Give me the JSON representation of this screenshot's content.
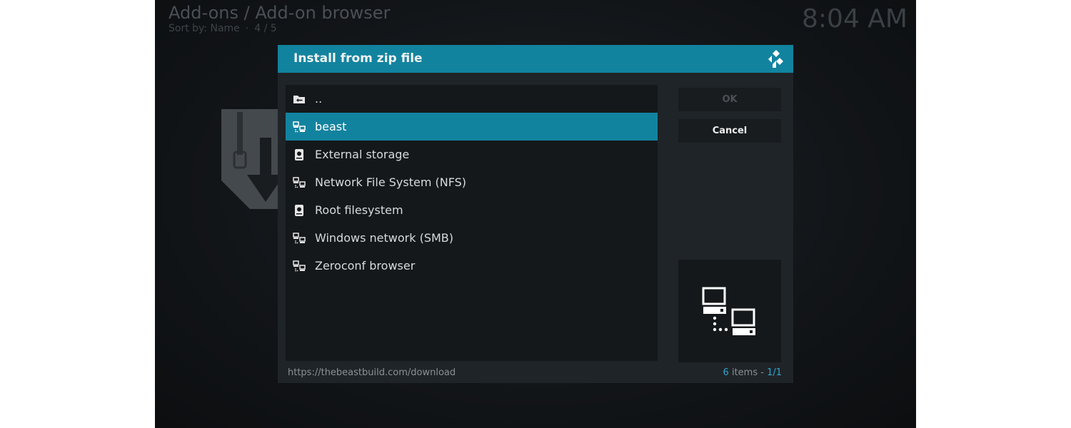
{
  "header": {
    "title": "Add-ons / Add-on browser",
    "sort_label": "Sort by: Name",
    "separator": "·",
    "position": "4 / 5"
  },
  "clock": "8:04 AM",
  "dialog": {
    "title": "Install from zip file",
    "items": [
      {
        "label": "..",
        "icon": "folder-back-icon"
      },
      {
        "label": "beast",
        "icon": "network-icon",
        "selected": true
      },
      {
        "label": "External storage",
        "icon": "drive-icon"
      },
      {
        "label": "Network File System (NFS)",
        "icon": "network-icon"
      },
      {
        "label": "Root filesystem",
        "icon": "drive-icon"
      },
      {
        "label": "Windows network (SMB)",
        "icon": "network-icon"
      },
      {
        "label": "Zeroconf browser",
        "icon": "network-icon"
      }
    ],
    "buttons": {
      "ok": "OK",
      "cancel": "Cancel"
    },
    "footer": {
      "path": "https://thebeastbuild.com/download",
      "count": "6",
      "count_suffix": "items -",
      "page": "1/1"
    }
  },
  "colors": {
    "accent": "#12839f",
    "accent_text": "#2fa8cf",
    "dialog_bg": "#1f2428"
  }
}
